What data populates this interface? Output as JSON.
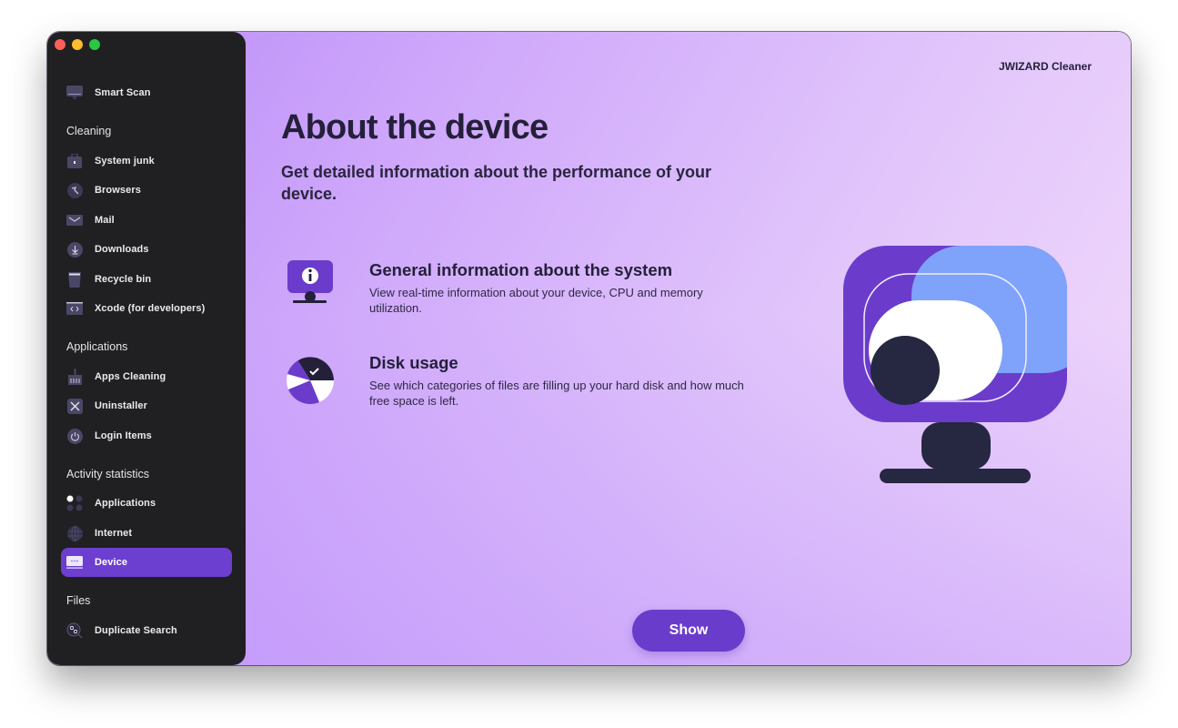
{
  "app": {
    "name": "JWIZARD Cleaner"
  },
  "sidebar": {
    "top_item": {
      "label": "Smart Scan",
      "icon": "monitor-icon"
    },
    "sections": [
      {
        "title": "Cleaning",
        "items": [
          {
            "label": "System junk",
            "icon": "briefcase-icon"
          },
          {
            "label": "Browsers",
            "icon": "compass-icon"
          },
          {
            "label": "Mail",
            "icon": "mail-icon"
          },
          {
            "label": "Downloads",
            "icon": "download-icon"
          },
          {
            "label": "Recycle bin",
            "icon": "trash-icon"
          },
          {
            "label": "Xcode (for developers)",
            "icon": "code-icon"
          }
        ]
      },
      {
        "title": "Applications",
        "items": [
          {
            "label": "Apps Cleaning",
            "icon": "broom-icon"
          },
          {
            "label": "Uninstaller",
            "icon": "x-box-icon"
          },
          {
            "label": "Login Items",
            "icon": "power-icon"
          }
        ]
      },
      {
        "title": "Activity statistics",
        "items": [
          {
            "label": "Applications",
            "icon": "apps-grid-icon"
          },
          {
            "label": "Internet",
            "icon": "globe-icon"
          },
          {
            "label": "Device",
            "icon": "device-icon",
            "active": true
          }
        ]
      },
      {
        "title": "Files",
        "items": [
          {
            "label": "Duplicate Search",
            "icon": "duplicate-search-icon"
          }
        ]
      }
    ]
  },
  "main": {
    "title": "About the device",
    "subtitle": "Get detailed information about the performance of your device.",
    "features": [
      {
        "title": "General information about the system",
        "description": "View real-time information about your device, CPU and memory utilization.",
        "icon": "monitor-info-icon"
      },
      {
        "title": "Disk usage",
        "description": "See which categories of files are filling up your hard disk and how much free space is left.",
        "icon": "pie-chart-check-icon"
      }
    ],
    "action_button": "Show"
  },
  "colors": {
    "accent": "#6a3ccc",
    "sidebar_bg": "#201f22",
    "text_dark": "#24203a",
    "illustration_blue": "#7fa3fa",
    "illustration_navy": "#262740"
  }
}
